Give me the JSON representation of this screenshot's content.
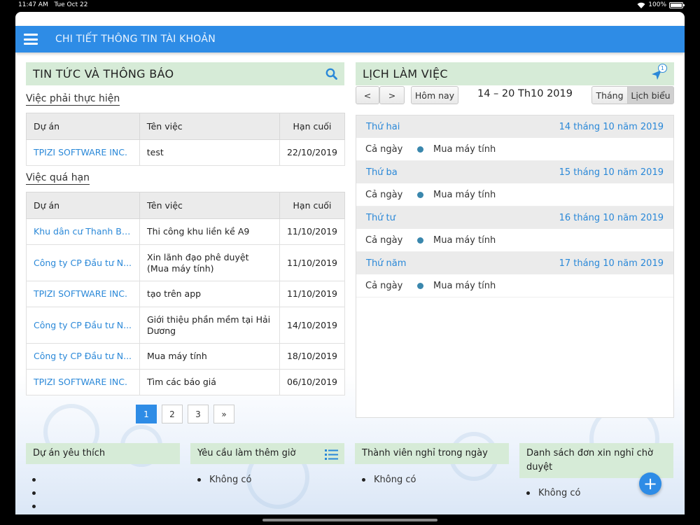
{
  "status": {
    "time": "11:47 AM",
    "date": "Tue Oct 22",
    "battery": "100%",
    "battery_level": 1.0
  },
  "appbar": {
    "title": "CHI TIẾT THÔNG TIN TÀI KHOẢN"
  },
  "news": {
    "header": "TIN TỨC VÀ THÔNG BÁO",
    "todo_title": "Việc phải thực hiện",
    "overdue_title": "Việc quá hạn",
    "columns": {
      "project": "Dự án",
      "task": "Tên việc",
      "due": "Hạn cuối"
    },
    "todo_rows": [
      {
        "project": "TPIZI SOFTWARE INC.",
        "task": "test",
        "due": "22/10/2019"
      }
    ],
    "overdue_rows": [
      {
        "project": "Khu dân cư Thanh Bì...",
        "task": "Thi công khu liền kề A9",
        "due": "11/10/2019"
      },
      {
        "project": "Công ty CP Đầu tư N...",
        "task": "Xin lãnh đạo phê duyệt (Mua máy tính)",
        "due": "11/10/2019"
      },
      {
        "project": "TPIZI SOFTWARE INC.",
        "task": "tạo trên app",
        "due": "11/10/2019"
      },
      {
        "project": "Công ty CP Đầu tư N...",
        "task": "Giới thiệu phần mềm tại Hải Dương",
        "due": "14/10/2019"
      },
      {
        "project": "Công ty CP Đầu tư N...",
        "task": "Mua máy tính",
        "due": "18/10/2019"
      },
      {
        "project": "TPIZI SOFTWARE INC.",
        "task": "Tìm các báo giá",
        "due": "06/10/2019"
      }
    ],
    "pager": [
      "1",
      "2",
      "3",
      "»"
    ],
    "pager_active": "1"
  },
  "calendar": {
    "header": "LỊCH LÀM VIỆC",
    "badge": "1",
    "prev": "<",
    "next": ">",
    "today_label": "Hôm nay",
    "range": "14 – 20 Th10 2019",
    "view_month": "Tháng",
    "view_list": "Lịch biểu",
    "days": [
      {
        "weekday": "Thứ hai",
        "date": "14 tháng 10 năm 2019",
        "when": "Cả ngày",
        "event": "Mua máy tính"
      },
      {
        "weekday": "Thứ ba",
        "date": "15 tháng 10 năm 2019",
        "when": "Cả ngày",
        "event": "Mua máy tính"
      },
      {
        "weekday": "Thứ tư",
        "date": "16 tháng 10 năm 2019",
        "when": "Cả ngày",
        "event": "Mua máy tính"
      },
      {
        "weekday": "Thứ năm",
        "date": "17 tháng 10 năm 2019",
        "when": "Cả ngày",
        "event": "Mua máy tính"
      }
    ]
  },
  "bottom": {
    "favorites": {
      "title": "Dự án yêu thích",
      "items": [
        "",
        "",
        ""
      ]
    },
    "overtime": {
      "title": "Yêu cầu làm thêm giờ",
      "items": [
        "Không có"
      ]
    },
    "leave_today": {
      "title": "Thành viên nghỉ trong ngày",
      "items": [
        "Không có"
      ]
    },
    "pending_leave": {
      "title": "Danh sách đơn xin nghỉ chờ duyệt",
      "items": [
        "Không có"
      ]
    }
  },
  "fab": {
    "label": "+"
  }
}
